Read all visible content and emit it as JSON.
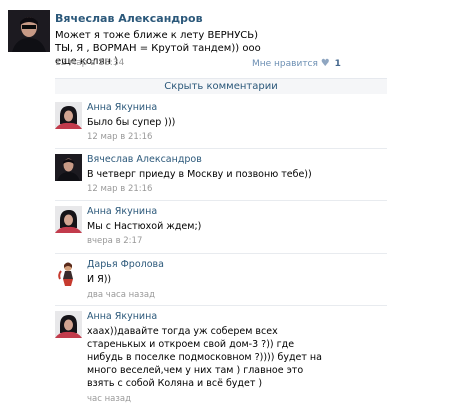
{
  "post": {
    "author": "Вячеслав Александров",
    "text": "Может я тоже ближе к лету ВЕРНУСЬ) ТЫ, Я , ВОРМАН = Крутой тандем)) ооо еще колян )",
    "date": "12 мар в 18:34",
    "like_label": "Мне нравится",
    "like_icon": "heart-icon",
    "like_count": "1"
  },
  "hide_comments_label": "Скрыть комментарии",
  "comments": [
    {
      "name": "Анна Якунина",
      "text": "Было бы супер )))",
      "date": "12 мар в 21:16"
    },
    {
      "name": "Вячеслав Александров",
      "text": "В четверг приеду в Москву и позвоню тебе))",
      "date": "12 мар в 21:16"
    },
    {
      "name": "Анна Якунина",
      "text": "Мы с Настюхой ждем;)",
      "date": "вчера в 2:17"
    },
    {
      "name": "Дарья Фролова",
      "text": "И Я))",
      "date": "два часа назад"
    },
    {
      "name": "Анна Якунина",
      "text": "хаах))давайте тогда уж соберем всех старенькых и откроем свой дом-3 ?)) где нибудь в поселке подмосковном ?)))) будет на много веселей,чем у них там ) главное это взять с собой Коляна и всё будет )",
      "date": "час назад"
    }
  ]
}
